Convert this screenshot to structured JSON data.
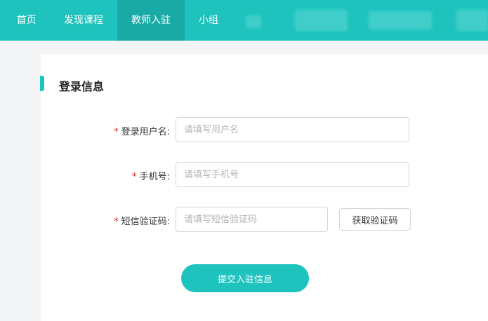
{
  "nav": {
    "items": [
      {
        "label": "首页"
      },
      {
        "label": "发现课程"
      },
      {
        "label": "教师入驻"
      },
      {
        "label": "小组"
      }
    ],
    "active_index": 2
  },
  "section": {
    "title": "登录信息"
  },
  "form": {
    "required_mark": "*",
    "username": {
      "label": "登录用户名:",
      "placeholder": "请填写用户名"
    },
    "phone": {
      "label": "手机号:",
      "placeholder": "请填写手机号"
    },
    "sms_code": {
      "label": "短信验证码:",
      "placeholder": "请填写短信验证码"
    },
    "get_code_label": "获取验证码",
    "submit_label": "提交入驻信息"
  },
  "colors": {
    "accent": "#1ec3be",
    "nav_active": "#1aaaa6",
    "required": "#e0262d"
  }
}
